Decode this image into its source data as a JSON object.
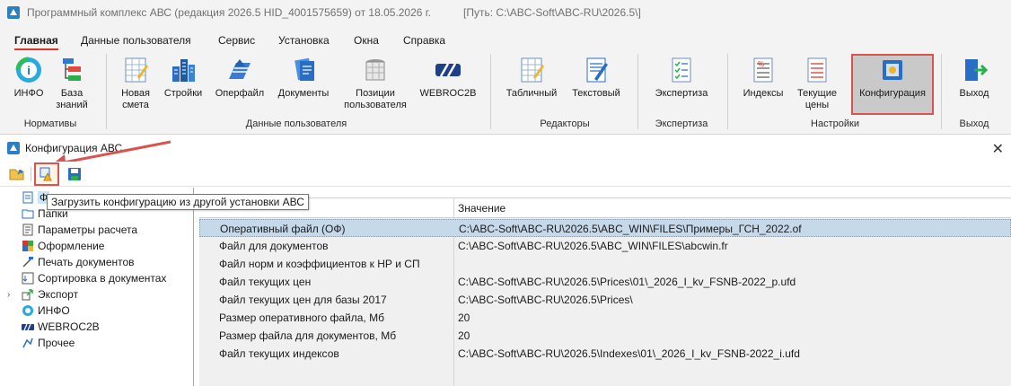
{
  "window": {
    "title": "Программный комплекс АВС (редакция 2026.5 HID_4001575659) от 18.05.2026 г.",
    "path": "[Путь: C:\\ABC-Soft\\ABC-RU\\2026.5\\]"
  },
  "menu": [
    "Главная",
    "Данные пользователя",
    "Сервис",
    "Установка",
    "Окна",
    "Справка"
  ],
  "ribbon": {
    "buttons": {
      "info": "ИНФО",
      "knowledge_base_1": "База",
      "knowledge_base_2": "знаний",
      "new_estimate_1": "Новая",
      "new_estimate_2": "смета",
      "construction": "Стройки",
      "operfile": "Оперфайл",
      "documents": "Документы",
      "user_positions_1": "Позиции",
      "user_positions_2": "пользователя",
      "webroc2b": "WEBROC2B",
      "tabular": "Табличный",
      "text": "Текстовый",
      "expertise": "Экспертиза",
      "indices": "Индексы",
      "current_prices_1": "Текущие",
      "current_prices_2": "цены",
      "configuration": "Конфигурация",
      "exit": "Выход"
    },
    "groups": {
      "normatives": "Нормативы",
      "user_data": "Данные пользователя",
      "editors": "Редакторы",
      "expertise": "Экспертиза",
      "settings": "Настройки",
      "exit": "Выход"
    }
  },
  "child_window": {
    "title": "Конфигурация АВС",
    "tooltip": "Загрузить конфигурацию из другой установки АВС"
  },
  "tree": {
    "items": [
      {
        "label": "Файлы",
        "visible": "Ф",
        "icon": "files-icon"
      },
      {
        "label": "Папки",
        "icon": "folder-icon"
      },
      {
        "label": "Параметры расчета",
        "icon": "calc-params-icon"
      },
      {
        "label": "Оформление",
        "icon": "palette-icon"
      },
      {
        "label": "Печать документов",
        "icon": "print-icon"
      },
      {
        "label": "Сортировка в документах",
        "icon": "sort-icon"
      },
      {
        "label": "Экспорт",
        "icon": "export-icon"
      },
      {
        "label": "ИНФО",
        "icon": "info-icon"
      },
      {
        "label": "WEBROC2B",
        "icon": "webroc-icon"
      },
      {
        "label": "Прочее",
        "icon": "other-icon"
      }
    ]
  },
  "grid": {
    "columns": [
      "",
      "Значение"
    ],
    "rows": [
      {
        "name": "Оперативный файл (ОФ)",
        "value": "C:\\ABC-Soft\\ABC-RU\\2026.5\\ABC_WIN\\FILES\\Примеры_ГСН_2022.of"
      },
      {
        "name": "Файл для документов",
        "value": "C:\\ABC-Soft\\ABC-RU\\2026.5\\ABC_WIN\\FILES\\abcwin.fr"
      },
      {
        "name": "Файл норм и коэффициентов к НР и СП",
        "value": ""
      },
      {
        "name": "Файл текущих цен",
        "value": "C:\\ABC-Soft\\ABC-RU\\2026.5\\Prices\\01\\_2026_I_kv_FSNB-2022_p.ufd"
      },
      {
        "name": "Файл текущих цен для базы 2017",
        "value": "C:\\ABC-Soft\\ABC-RU\\2026.5\\Prices\\"
      },
      {
        "name": "Размер оперативного файла, Мб",
        "value": "20"
      },
      {
        "name": "Размер файла для документов, Мб",
        "value": "20"
      },
      {
        "name": "Файл текущих индексов",
        "value": "C:\\ABC-Soft\\ABC-RU\\2026.5\\Indexes\\01\\_2026_I_kv_FSNB-2022_i.ufd"
      }
    ]
  },
  "colors": {
    "accent_red": "#d9534f",
    "selection": "#c5d9ea",
    "ribbon_bg": "#f3f3f3"
  }
}
